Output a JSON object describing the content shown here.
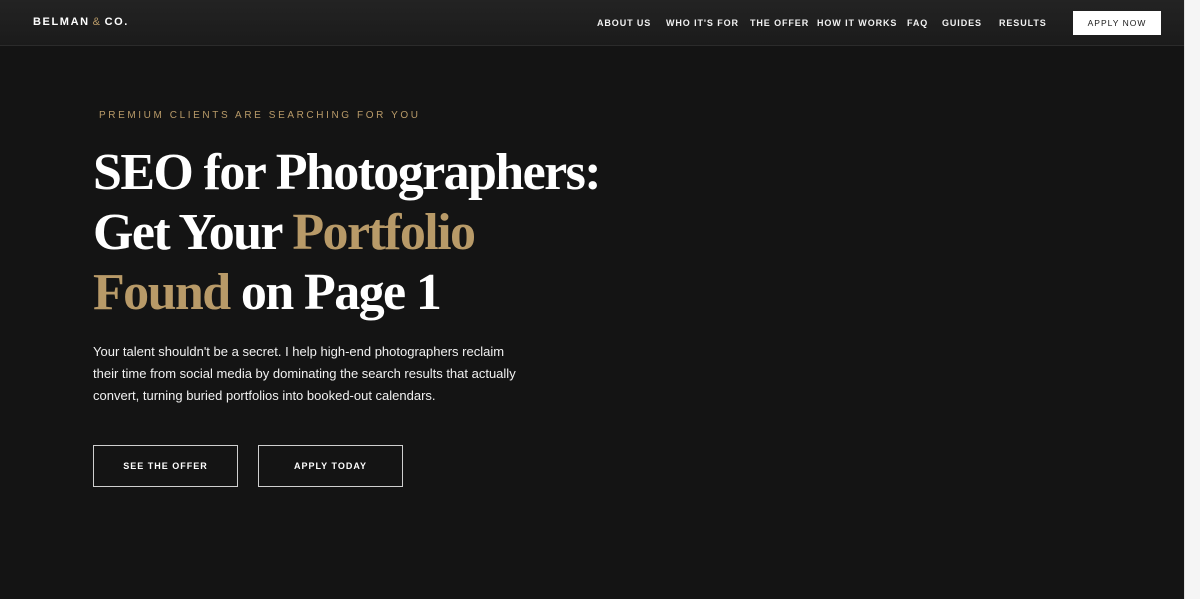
{
  "header": {
    "logo": {
      "name": "BELMAN",
      "amp": "&",
      "suffix": "CO."
    },
    "nav": [
      {
        "label": "ABOUT US"
      },
      {
        "label": "WHO IT'S FOR"
      },
      {
        "label": "THE OFFER"
      },
      {
        "label": "HOW IT WORKS"
      },
      {
        "label": "FAQ"
      },
      {
        "label": "GUIDES"
      },
      {
        "label": "RESULTS"
      }
    ],
    "cta_label": "APPLY NOW"
  },
  "hero": {
    "eyebrow": "PREMIUM CLIENTS ARE SEARCHING FOR YOU",
    "headline": {
      "line1": "SEO for Photographers:",
      "line2_white": "Get Your ",
      "line2_gold": "Portfolio",
      "line3_gold": "Found",
      "line3_white": " on Page 1"
    },
    "description_lines": [
      "Your talent shouldn't be a secret. I help high-end photographers reclaim",
      "their time from social media by dominating the search results that actually",
      "convert, turning buried portfolios into booked-out calendars."
    ],
    "buttons": {
      "offer": "SEE THE OFFER",
      "apply": "APPLY TODAY"
    }
  },
  "colors": {
    "accent_gold": "#b89a68",
    "background": "#141414",
    "text": "#ffffff"
  }
}
